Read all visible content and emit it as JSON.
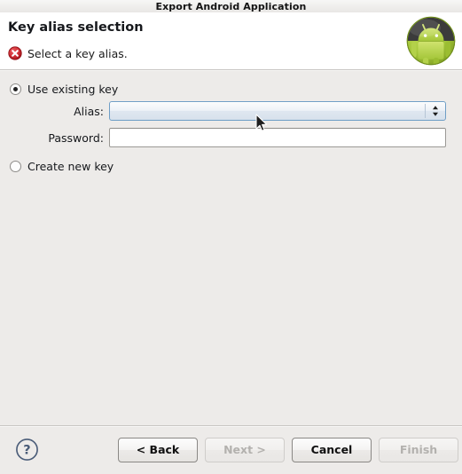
{
  "window": {
    "title": "Export Android Application"
  },
  "header": {
    "title": "Key alias selection",
    "message": "Select a key alias.",
    "message_icon": "error-circle-icon",
    "brand_icon": "android-robot-icon"
  },
  "form": {
    "use_existing_key": {
      "label": "Use existing key",
      "selected": true
    },
    "create_new_key": {
      "label": "Create new key",
      "selected": false
    },
    "alias": {
      "label": "Alias:",
      "value": "",
      "placeholder": "",
      "options": []
    },
    "password": {
      "label": "Password:",
      "value": "",
      "placeholder": ""
    }
  },
  "footer": {
    "help_icon": "question-mark-circle-icon",
    "buttons": [
      {
        "label": "< Back",
        "enabled": true,
        "name": "back-button"
      },
      {
        "label": "Next >",
        "enabled": false,
        "name": "next-button"
      },
      {
        "label": "Cancel",
        "enabled": true,
        "name": "cancel-button"
      },
      {
        "label": "Finish",
        "enabled": false,
        "name": "finish-button"
      }
    ]
  },
  "colors": {
    "dialog_background": "#edebe9",
    "header_background": "#ffffff",
    "error_red": "#cc2127",
    "android_green": "#a4c639",
    "focus_blue": "#6f9ec6",
    "help_blue": "#4a5c78"
  }
}
